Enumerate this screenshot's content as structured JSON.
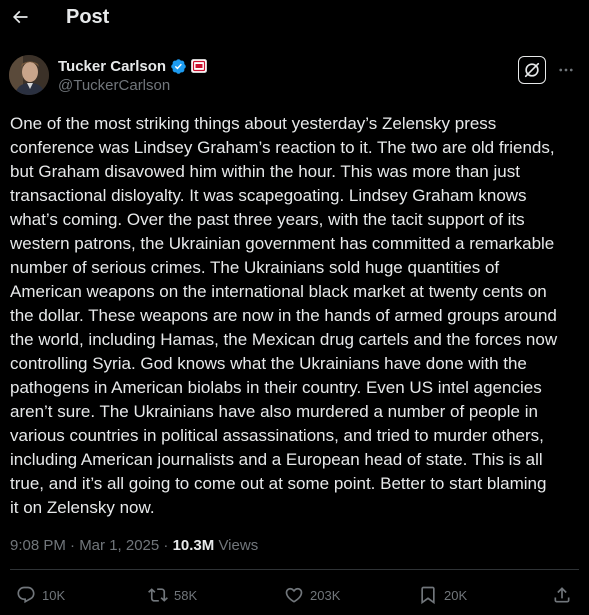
{
  "header": {
    "title": "Post"
  },
  "author": {
    "display_name": "Tucker Carlson",
    "handle": "@TuckerCarlson"
  },
  "post": {
    "text": "One of the most striking things about yesterday’s Zelensky press\nconference was Lindsey Graham’s reaction to it. The two are old friends,\nbut Graham disavowed him within the hour. This was more than just\ntransactional disloyalty. It was scapegoating. Lindsey Graham knows\nwhat’s coming. Over the past three years, with the tacit support of its\nwestern patrons, the Ukrainian government has committed a remarkable\nnumber of serious crimes. The Ukrainians sold huge quantities of\nAmerican weapons on the international black market at twenty cents on\nthe dollar. These weapons are now in the hands of armed groups around\nthe world, including Hamas, the Mexican drug cartels and the forces now\ncontrolling Syria. God knows what the Ukrainians have done with the\npathogens in American biolabs in their country. Even US intel agencies\naren’t sure. The Ukrainians have also murdered a number of people in\nvarious countries in political assassinations, and tried to murder others,\nincluding American journalists and a European head of state. This is all\ntrue, and it’s all going to come out at some point. Better to start blaming\nit on Zelensky now.",
    "time": "9:08 PM · Mar 1, 2025 · ",
    "views_count": "10.3M",
    "views_label": " Views"
  },
  "actions": {
    "replies": "10K",
    "reposts": "58K",
    "likes": "203K",
    "bookmarks": "20K"
  },
  "colors": {
    "background": "#000000",
    "text": "#e7e9ea",
    "muted": "#71767b",
    "verified": "#1d9bf0",
    "divider": "#2f3336"
  },
  "icons": [
    "back-arrow-icon",
    "verified-badge-icon",
    "affiliate-badge-icon",
    "grok-icon",
    "more-icon",
    "reply-icon",
    "repost-icon",
    "like-icon",
    "bookmark-icon",
    "share-icon"
  ]
}
